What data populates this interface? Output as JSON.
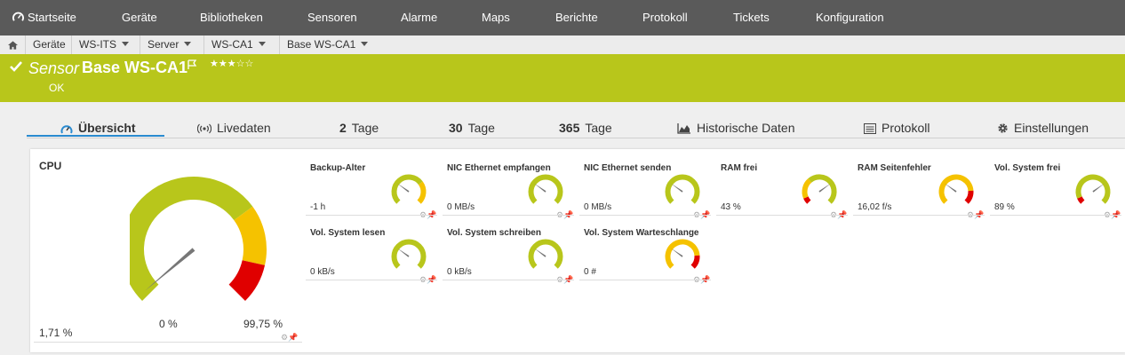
{
  "nav": {
    "items": [
      "Startseite",
      "Geräte",
      "Bibliotheken",
      "Sensoren",
      "Alarme",
      "Maps",
      "Berichte",
      "Protokoll",
      "Tickets",
      "Konfiguration"
    ]
  },
  "breadcrumb": {
    "items": [
      "Geräte",
      "WS-ITS",
      "Server",
      "WS-CA1",
      "Base WS-CA1"
    ]
  },
  "header": {
    "type": "Sensor",
    "name": "Base WS-CA1",
    "stars": "★★★☆☆",
    "status": "OK",
    "color": "#b8c61b"
  },
  "tabs": [
    {
      "bold": "",
      "label": "Übersicht",
      "icon": "gauge-icon"
    },
    {
      "bold": "",
      "label": "Livedaten",
      "icon": "broadcast-icon"
    },
    {
      "bold": "2",
      "label": "Tage",
      "icon": ""
    },
    {
      "bold": "30",
      "label": "Tage",
      "icon": ""
    },
    {
      "bold": "365",
      "label": "Tage",
      "icon": ""
    },
    {
      "bold": "",
      "label": "Historische Daten",
      "icon": "area-chart-icon"
    },
    {
      "bold": "",
      "label": "Protokoll",
      "icon": "list-icon"
    },
    {
      "bold": "",
      "label": "Einstellungen",
      "icon": "gear-icon"
    }
  ],
  "cpu": {
    "title": "CPU",
    "value": "1,71 %",
    "min_label": "0 %",
    "max_label": "99,75 %",
    "level": 0.017,
    "yellow_from": 0.7,
    "red_from": 0.88
  },
  "channels": [
    {
      "name": "Backup-Alter",
      "value": "-1 h",
      "level": 0.3,
      "zones": "green-yellow"
    },
    {
      "name": "NIC Ethernet empfangen",
      "value": "0 MB/s",
      "level": 0.3,
      "zones": "green"
    },
    {
      "name": "NIC Ethernet senden",
      "value": "0 MB/s",
      "level": 0.3,
      "zones": "green"
    },
    {
      "name": "RAM frei",
      "value": "43 %",
      "level": 0.7,
      "zones": "red-yellow-green"
    },
    {
      "name": "RAM Seitenfehler",
      "value": "16,02 f/s",
      "level": 0.3,
      "zones": "yellow-red"
    },
    {
      "name": "Vol. System frei",
      "value": "89 %",
      "level": 0.7,
      "zones": "red-green"
    },
    {
      "name": "Vol. System lesen",
      "value": "0 kB/s",
      "level": 0.3,
      "zones": "green"
    },
    {
      "name": "Vol. System schreiben",
      "value": "0 kB/s",
      "level": 0.3,
      "zones": "green"
    },
    {
      "name": "Vol. System Warteschlange",
      "value": "0 #",
      "level": 0.3,
      "zones": "yellow-red"
    }
  ],
  "colors": {
    "green": "#b8c61b",
    "yellow": "#f5c200",
    "red": "#e00000",
    "needle": "#777777",
    "tab_active": "#2a8bd0"
  }
}
